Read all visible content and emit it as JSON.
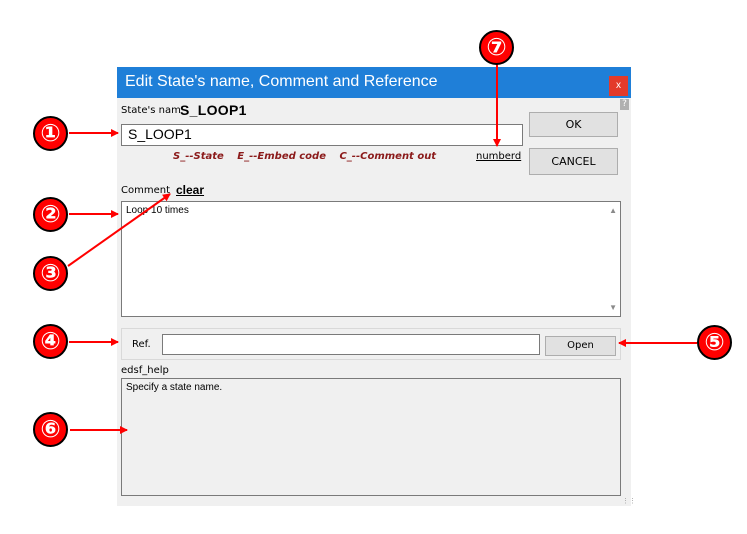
{
  "dialog": {
    "title": "Edit State's name, Comment and Reference",
    "close_glyph": "x",
    "help_glyph": "?",
    "state_name_label": "State's nam",
    "state_name_value": "S_LOOP1",
    "name_input_value": "S_LOOP1",
    "ok_label": "OK",
    "cancel_label": "CANCEL",
    "legend": {
      "state": "S_--State",
      "embed": "E_--Embed code",
      "comment_out": "C_--Comment out"
    },
    "numberd_label": "numberd",
    "comment_label": "Comment",
    "clear_label": "clear",
    "comment_value": "Loop 10 times",
    "ref_label": "Ref.",
    "ref_value": "",
    "open_label": "Open",
    "help_label": "edsf_help",
    "help_text": "Specify a state name."
  },
  "callouts": [
    "①",
    "②",
    "③",
    "④",
    "⑤",
    "⑥",
    "⑦"
  ],
  "colors": {
    "titlebar": "#1f7fd8",
    "close_button": "#e33a2a",
    "callout": "#ff0000",
    "legend_text": "#8b1a1a"
  }
}
